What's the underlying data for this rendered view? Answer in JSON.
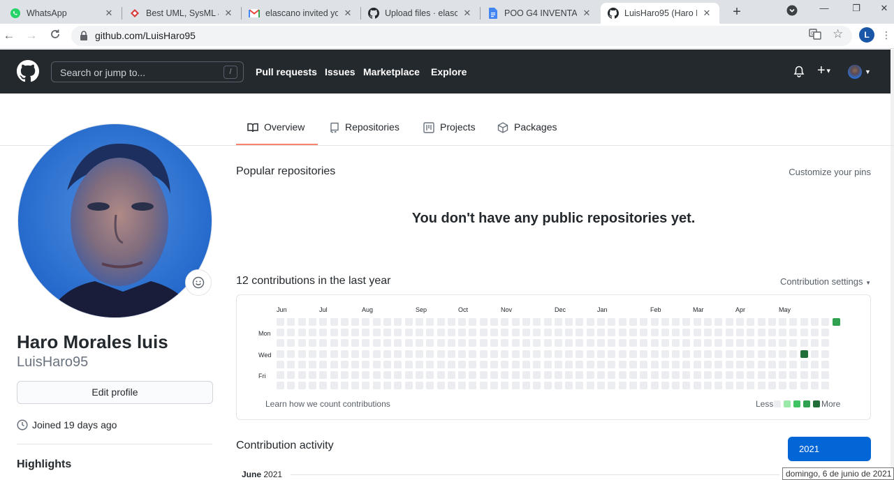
{
  "browser": {
    "tabs": [
      {
        "title": "WhatsApp",
        "icon": "whatsapp-icon"
      },
      {
        "title": "Best UML, SysML &",
        "icon": "visual-paradigm-icon"
      },
      {
        "title": "elascano invited yo",
        "icon": "gmail-icon"
      },
      {
        "title": "Upload files · elasca",
        "icon": "github-icon"
      },
      {
        "title": "POO G4 INVENTAR",
        "icon": "google-docs-icon"
      },
      {
        "title": "LuisHaro95 (Haro M",
        "icon": "github-icon",
        "active": true
      }
    ],
    "url": "github.com/LuisHaro95",
    "profile_initial": "L"
  },
  "header": {
    "search_placeholder": "Search or jump to...",
    "search_shortcut": "/",
    "nav": [
      "Pull requests",
      "Issues",
      "Marketplace",
      "Explore"
    ]
  },
  "profile_tabs": [
    "Overview",
    "Repositories",
    "Projects",
    "Packages"
  ],
  "profile": {
    "full_name": "Haro Morales luis",
    "username": "LuisHaro95",
    "edit_button": "Edit profile",
    "joined": "Joined 19 days ago",
    "highlights_heading": "Highlights"
  },
  "popular": {
    "heading": "Popular repositories",
    "customize_link": "Customize your pins",
    "empty_message": "You don't have any public repositories yet."
  },
  "contributions": {
    "heading": "12 contributions in the last year",
    "settings_link": "Contribution settings",
    "months": [
      "Jun",
      "Jul",
      "Aug",
      "Sep",
      "Oct",
      "Nov",
      "Dec",
      "Jan",
      "Feb",
      "Mar",
      "Apr",
      "May"
    ],
    "day_labels": [
      "Mon",
      "Wed",
      "Fri"
    ],
    "learn_link": "Learn how we count contributions",
    "legend_less": "Less",
    "legend_more": "More",
    "colors": {
      "empty": "#ebedf0",
      "l1": "#9be9a8",
      "l2": "#40c463",
      "l3": "#30a14e",
      "l4": "#216e39"
    }
  },
  "activity": {
    "heading": "Contribution activity",
    "year_button": "2021",
    "month_name": "June",
    "month_year": "2021"
  },
  "tooltip": "domingo, 6 de junio de 2021"
}
